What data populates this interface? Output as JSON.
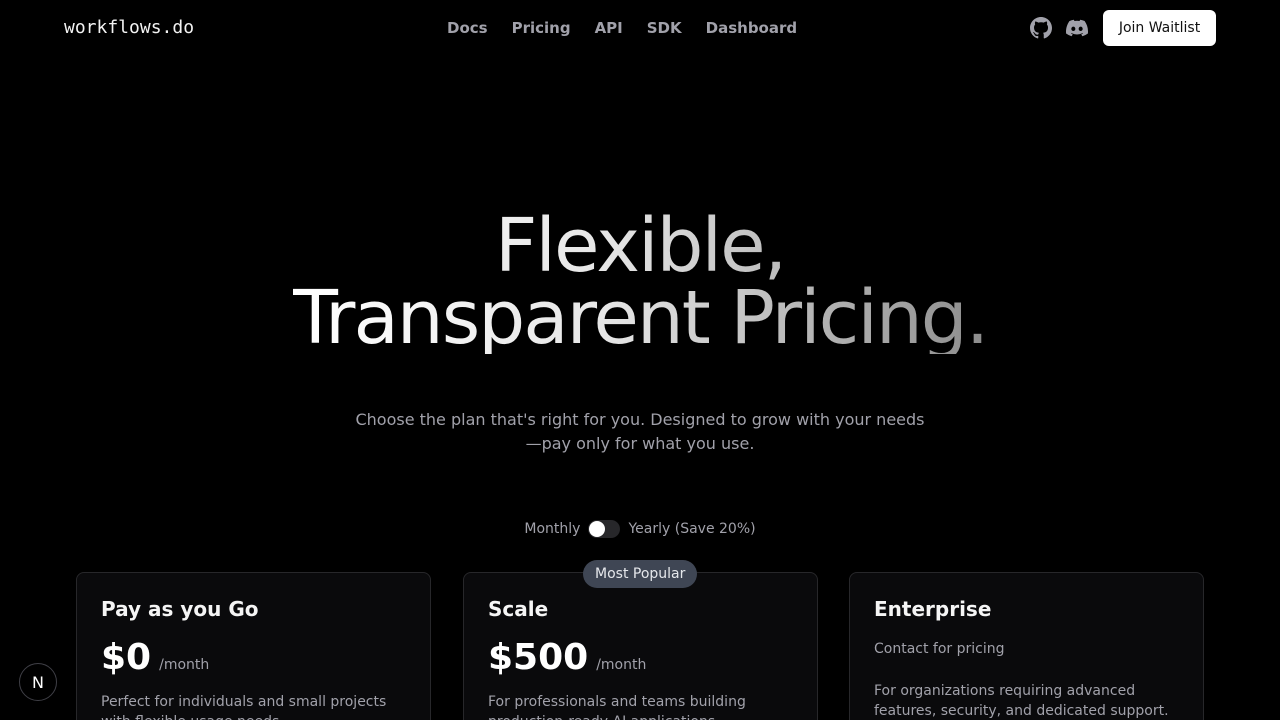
{
  "header": {
    "logo": "workflows.do",
    "nav": [
      "Docs",
      "Pricing",
      "API",
      "SDK",
      "Dashboard"
    ],
    "icons": [
      "github-icon",
      "discord-icon"
    ],
    "cta": "Join Waitlist"
  },
  "hero": {
    "title_line1": "Flexible,",
    "title_line2": "Transparent Pricing.",
    "subtitle_line1": "Choose the plan that's right for you. Designed to grow with your needs",
    "subtitle_line2": "—pay only for what you use."
  },
  "billing": {
    "monthly": "Monthly",
    "yearly": "Yearly (Save 20%)",
    "yearly_selected": false
  },
  "plans": [
    {
      "name": "Pay as you Go",
      "price": "$0",
      "period": "/month",
      "description": "Perfect for individuals and small projects with flexible usage needs."
    },
    {
      "name": "Scale",
      "badge": "Most Popular",
      "price": "$500",
      "period": "/month",
      "description": "For professionals and teams building production-ready AI applications."
    },
    {
      "name": "Enterprise",
      "contact": "Contact for pricing",
      "description": "For organizations requiring advanced features, security, and dedicated support."
    }
  ],
  "dev_badge": "N",
  "colors": {
    "background": "#000000",
    "card": "#0a0a0c",
    "muted": "#a1a1aa",
    "badge": "#3f4654"
  }
}
